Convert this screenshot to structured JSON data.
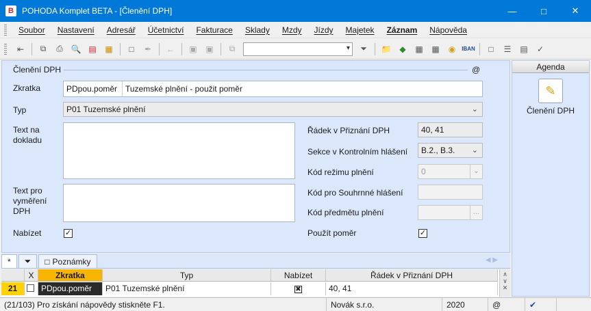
{
  "window": {
    "logo_text": "B",
    "title": "POHODA Komplet BETA - [Členění DPH]"
  },
  "menu": [
    "Soubor",
    "Nastavení",
    "Adresář",
    "Účetnictví",
    "Fakturace",
    "Sklady",
    "Mzdy",
    "Jízdy",
    "Majetek",
    "Záznam",
    "Nápověda"
  ],
  "form": {
    "section_title": "Členění DPH",
    "at_symbol": "@",
    "zkratka_label": "Zkratka",
    "zkratka_value": "PDpou.poměr",
    "zkratka_desc": "Tuzemské plnění - použit poměr",
    "typ_label": "Typ",
    "typ_value": "P01 Tuzemské plnění",
    "text_doklad_label": "Text na dokladu",
    "text_vymereni_label": "Text pro vyměření DPH",
    "nabizet_label": "Nabízet",
    "nabizet_checked": true,
    "radek_label": "Řádek v Přiznání DPH",
    "radek_value": "40, 41",
    "sekce_label": "Sekce v Kontrolním hlášení",
    "sekce_value": "B.2., B.3.",
    "rezim_label": "Kód režimu plnění",
    "rezim_value": "0",
    "souhrnne_label": "Kód pro Souhrnné hlášení",
    "souhrnne_value": "",
    "predmet_label": "Kód předmětu plnění",
    "predmet_value": "",
    "pouzit_label": "Použít poměr",
    "pouzit_checked": true
  },
  "agenda": {
    "header": "Agenda",
    "item_label": "Členění DPH",
    "icon": "notepad-check-icon"
  },
  "tabs": {
    "star": "*",
    "filter_icon": "filter-icon",
    "notes_label": "Poznámky"
  },
  "grid": {
    "columns": {
      "x": "X",
      "zkratka": "Zkratka",
      "typ": "Typ",
      "nabizet": "Nabízet",
      "radek": "Řádek v Přiznání DPH"
    },
    "rows": [
      {
        "num": "21",
        "zkratka": "PDpou.poměr",
        "typ": "P01 Tuzemské plnění",
        "nabizet": true,
        "radek": "40, 41"
      }
    ]
  },
  "status": {
    "help": "(21/103) Pro získání nápovědy stiskněte F1.",
    "company": "Novák s.r.o.",
    "year": "2020",
    "at": "@"
  },
  "colors": {
    "titlebar": "#0078d7",
    "panel": "#dbe8fc",
    "row_number": "#ffd200",
    "zkratka_header": "#f7b400"
  }
}
